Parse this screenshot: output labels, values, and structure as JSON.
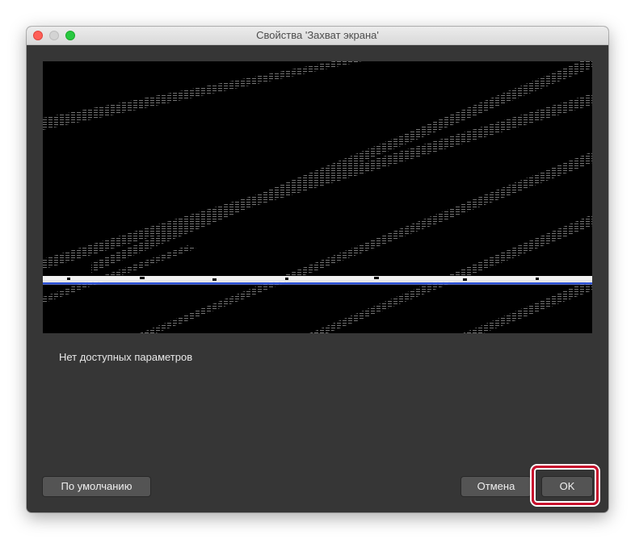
{
  "window": {
    "title": "Свойства 'Захват экрана'"
  },
  "info": {
    "message": "Нет доступных параметров"
  },
  "buttons": {
    "defaults_label": "По умолчанию",
    "cancel_label": "Отмена",
    "ok_label": "OK"
  },
  "colors": {
    "window_bg": "#363636",
    "titlebar_bg": "#e3e3e3",
    "button_bg": "#545454",
    "highlight": "#c8102e",
    "close": "#fe5f57",
    "maximize": "#28c840"
  }
}
